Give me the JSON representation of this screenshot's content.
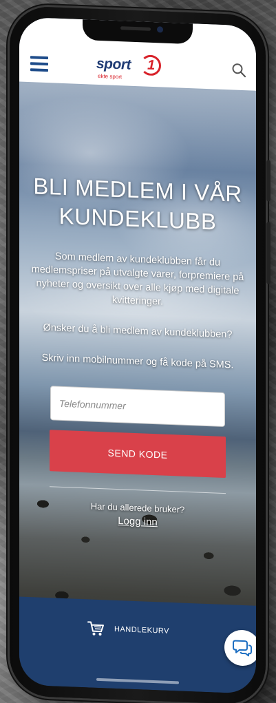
{
  "header": {
    "logo_text": "sport",
    "logo_number": "1",
    "logo_tagline": "ekte sport"
  },
  "hero": {
    "title": "BLI MEDLEM I VÅR KUNDEKLUBB",
    "description": "Som medlem av kundeklubben får du medlemspriser på utvalgte varer, forpremiere på nyheter og oversikt over alle kjøp med digitale kvitteringer.",
    "question": "Ønsker du å bli medlem av kundeklubben?",
    "instruction": "Skriv inn mobilnummer og få kode på SMS."
  },
  "form": {
    "phone_placeholder": "Telefonnummer",
    "send_label": "SEND KODE"
  },
  "login": {
    "question": "Har du allerede bruker?",
    "link_label": "Logg inn"
  },
  "bottom_bar": {
    "cart_label": "HANDLEKURV"
  },
  "colors": {
    "brand_blue": "#1f3b74",
    "brand_red": "#d8222a",
    "button_red": "#d9414a",
    "bottom_bar": "#1f3f6e"
  },
  "icons": {
    "menu": "menu-icon",
    "search": "search-icon",
    "cart": "shopping-cart-icon",
    "chat": "chat-bubble-icon"
  }
}
